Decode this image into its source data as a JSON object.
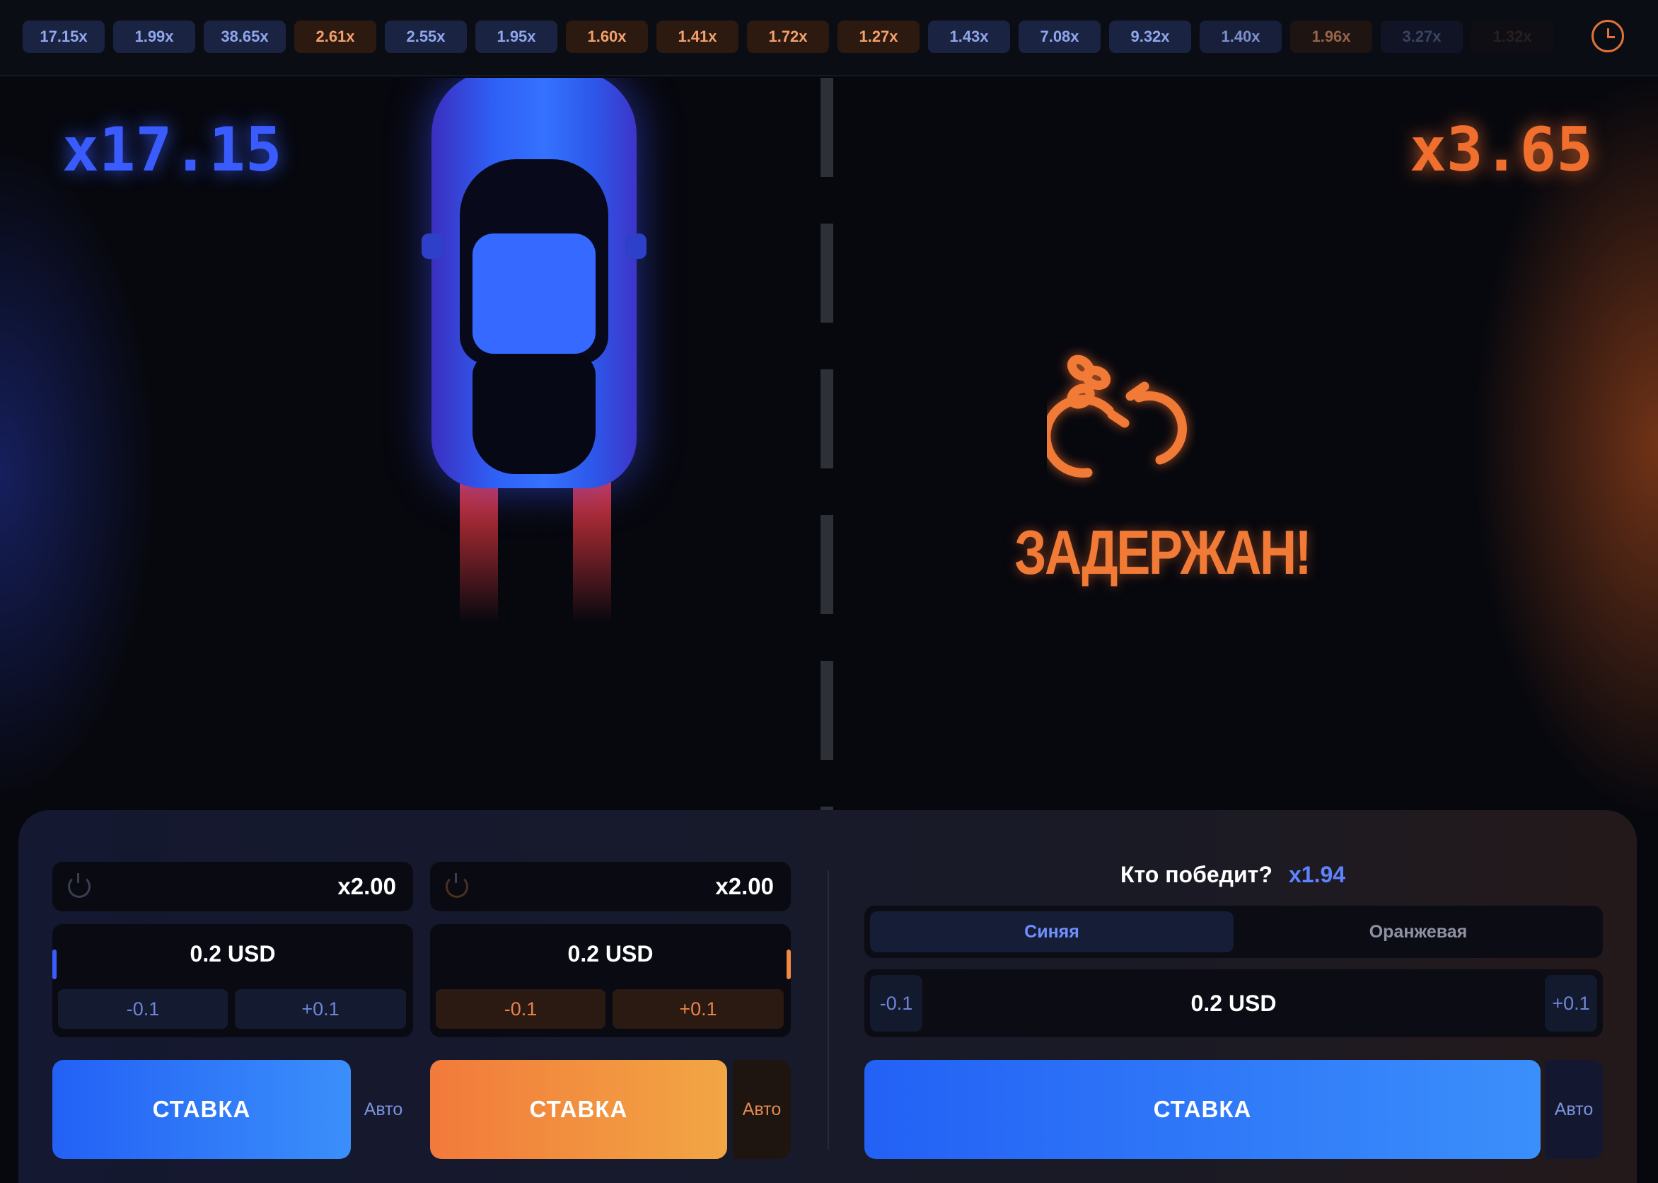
{
  "history": [
    {
      "value": "17.15x",
      "color": "blue"
    },
    {
      "value": "1.99x",
      "color": "blue"
    },
    {
      "value": "38.65x",
      "color": "blue"
    },
    {
      "value": "2.61x",
      "color": "orange"
    },
    {
      "value": "2.55x",
      "color": "blue"
    },
    {
      "value": "1.95x",
      "color": "blue"
    },
    {
      "value": "1.60x",
      "color": "orange"
    },
    {
      "value": "1.41x",
      "color": "orange"
    },
    {
      "value": "1.72x",
      "color": "orange"
    },
    {
      "value": "1.27x",
      "color": "orange"
    },
    {
      "value": "1.43x",
      "color": "blue"
    },
    {
      "value": "7.08x",
      "color": "blue"
    },
    {
      "value": "9.32x",
      "color": "blue"
    },
    {
      "value": "1.40x",
      "color": "blue"
    },
    {
      "value": "1.96x",
      "color": "orange"
    },
    {
      "value": "3.27x",
      "color": "blue"
    },
    {
      "value": "1.32x",
      "color": "orange"
    }
  ],
  "history_icon": "clock-icon",
  "race": {
    "blue_multiplier": "x17.15",
    "orange_multiplier": "x3.65",
    "status_text": "ЗАДЕРЖАН!",
    "status_icon": "handcuffs-icon"
  },
  "colors": {
    "blue": "#3a5cff",
    "orange": "#f06e2e",
    "background": "#07080e"
  },
  "panel_blue": {
    "autocashout": "x2.00",
    "amount": "0.2 USD",
    "minus": "-0.1",
    "plus": "+0.1",
    "bet_label": "СТАВКА",
    "auto_label": "Авто"
  },
  "panel_orange": {
    "autocashout": "x2.00",
    "amount": "0.2 USD",
    "minus": "-0.1",
    "plus": "+0.1",
    "bet_label": "СТАВКА",
    "auto_label": "Авто"
  },
  "panel_winner": {
    "question": "Кто победит?",
    "odds": "x1.94",
    "teams": [
      "Синяя",
      "Оранжевая"
    ],
    "selected_team": "Синяя",
    "amount": "0.2 USD",
    "minus": "-0.1",
    "plus": "+0.1",
    "bet_label": "СТАВКА",
    "auto_label": "Авто"
  }
}
